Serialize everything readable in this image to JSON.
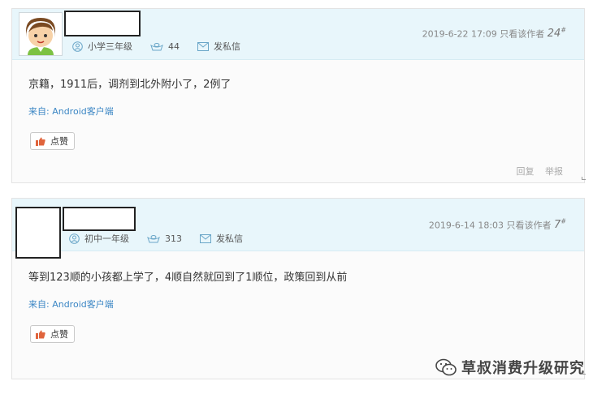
{
  "posts": [
    {
      "level": "小学三年级",
      "coins": "44",
      "message_label": "发私信",
      "datetime": "2019-6-22 17:09",
      "only_author_label": "只看该作者",
      "floor": "24",
      "floor_suffix": "#",
      "content": "京籍，1911后，调剂到北外附小了，2例了",
      "source": "来自: Android客户端",
      "like_label": "点赞",
      "reply_label": "回复",
      "report_label": "举报"
    },
    {
      "level": "初中一年级",
      "coins": "313",
      "message_label": "发私信",
      "datetime": "2019-6-14 18:03",
      "only_author_label": "只看该作者",
      "floor": "7",
      "floor_suffix": "#",
      "content": "等到123顺的小孩都上学了，4顺自然就回到了1顺位，政策回到从前",
      "source": "来自: Android客户端",
      "like_label": "点赞"
    }
  ],
  "watermark": {
    "text": "草叔消费升级研究"
  },
  "colors": {
    "header_bg": "#e8f6fb",
    "link": "#3b86c4",
    "like_icon": "#e0643c"
  }
}
